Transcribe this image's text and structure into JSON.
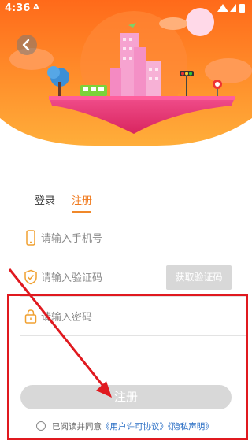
{
  "status": {
    "time": "4:36",
    "notification": "A"
  },
  "colors": {
    "accent": "#f07a1e",
    "link": "#2b6fc5",
    "disabled": "#d8d8d8",
    "highlight": "#e0191f"
  },
  "tabs": [
    {
      "label": "登录"
    },
    {
      "label": "注册"
    }
  ],
  "form": {
    "phone_placeholder": "请输入手机号",
    "code_placeholder": "请输入验证码",
    "password_placeholder": "请输入密码",
    "get_code_label": "获取验证码",
    "register_label": "注册"
  },
  "agreement": {
    "prefix": "已阅读并同意",
    "user_agreement": "《用户许可协议》",
    "privacy": "《隐私声明》"
  }
}
